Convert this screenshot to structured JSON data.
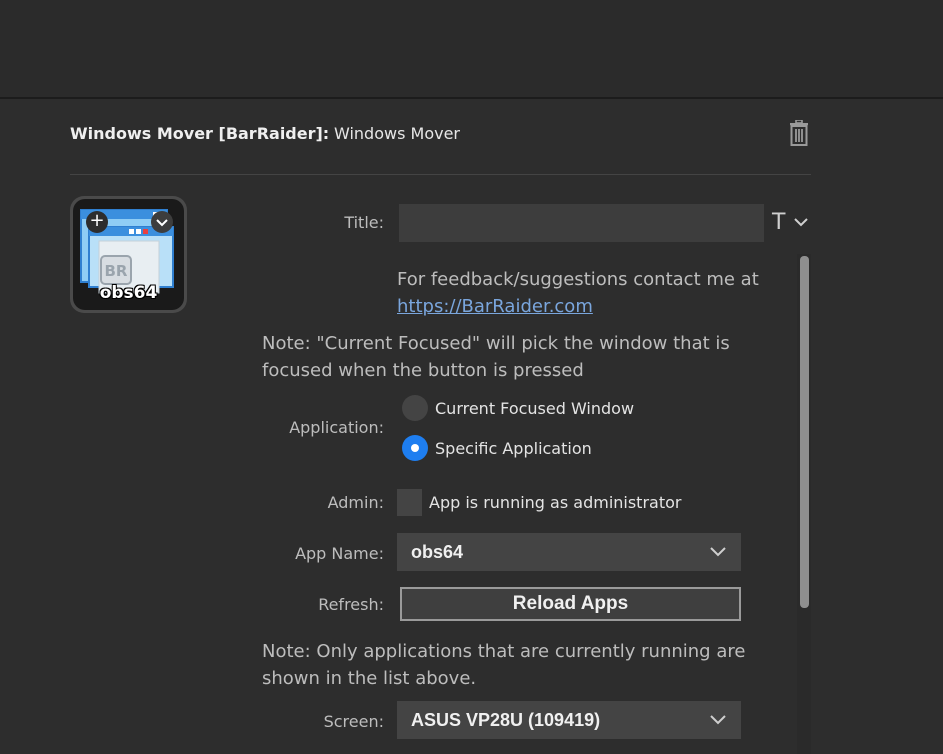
{
  "header": {
    "plugin_name": "Windows Mover [BarRaider]:",
    "action_name": "Windows Mover"
  },
  "key": {
    "label": "obs64",
    "icon_text": "BR"
  },
  "form": {
    "title_label": "Title:",
    "title_value": "",
    "feedback_text": "For feedback/suggestions contact me at",
    "feedback_link": "https://BarRaider.com",
    "note_focus": "Note: \"Current Focused\" will pick the window that is focused when the button is pressed",
    "application_label": "Application:",
    "app_options": [
      "Current Focused Window",
      "Specific Application"
    ],
    "app_selected": "Specific Application",
    "admin_label": "Admin:",
    "admin_checkbox": "App is running as administrator",
    "admin_checked": false,
    "app_name_label": "App Name:",
    "app_name_value": "obs64",
    "refresh_label": "Refresh:",
    "reload_button": "Reload Apps",
    "note_running": "Note: Only applications that are currently running are shown in the list above.",
    "screen_label": "Screen:",
    "screen_value": "ASUS VP28U (109419)"
  },
  "colors": {
    "accent": "#1e7ef0",
    "link": "#7aa6dd",
    "background": "#2d2d2d"
  }
}
